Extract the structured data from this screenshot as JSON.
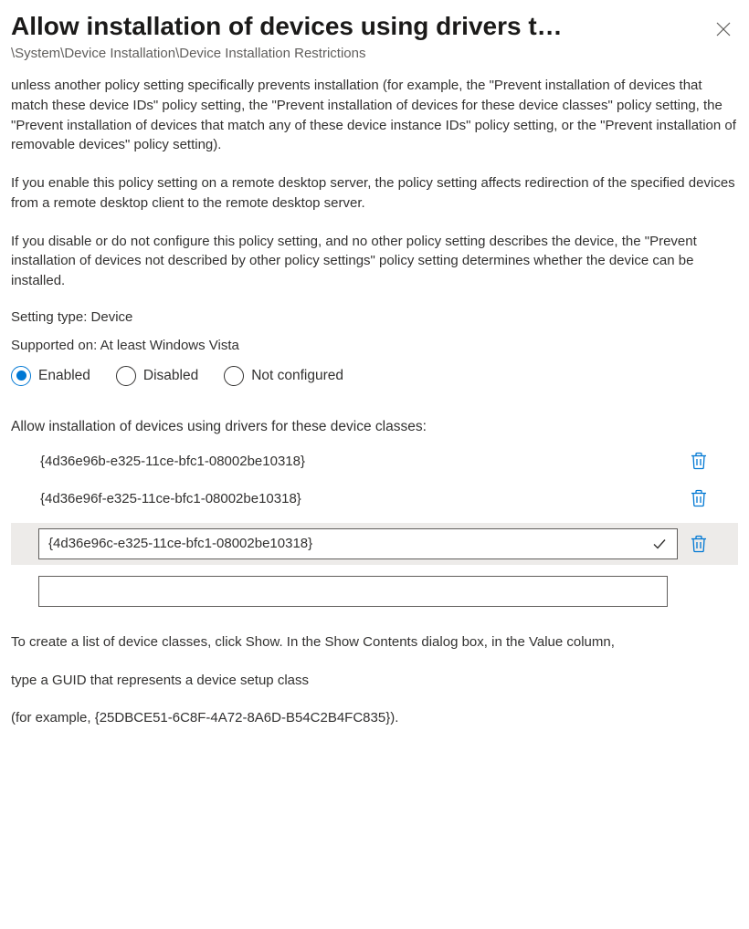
{
  "header": {
    "title": "Allow installation of devices using drivers t…",
    "breadcrumb": "\\System\\Device Installation\\Device Installation Restrictions"
  },
  "description": {
    "p1": "unless another policy setting specifically prevents installation (for example, the \"Prevent installation of devices that match these device IDs\" policy setting, the \"Prevent installation of devices for these device classes\" policy setting, the \"Prevent installation of devices that match any of these device instance IDs\" policy setting, or the \"Prevent installation of removable devices\" policy setting).",
    "p2": "If you enable this policy setting on a remote desktop server, the policy setting affects redirection of the specified devices from a remote desktop client to the remote desktop server.",
    "p3": "If you disable or do not configure this policy setting, and no other policy setting describes the device, the \"Prevent installation of devices not described by other policy settings\" policy setting determines whether the device can be installed."
  },
  "meta": {
    "setting_type": "Setting type: Device",
    "supported_on": "Supported on: At least Windows Vista"
  },
  "radio": {
    "selected": "enabled",
    "options": {
      "enabled": "Enabled",
      "disabled": "Disabled",
      "not_configured": "Not configured"
    }
  },
  "device_list": {
    "label": "Allow installation of devices using drivers for these device classes:",
    "rows": [
      {
        "value": "{4d36e96b-e325-11ce-bfc1-08002be10318}",
        "editing": false
      },
      {
        "value": "{4d36e96f-e325-11ce-bfc1-08002be10318}",
        "editing": false
      },
      {
        "value": "{4d36e96c-e325-11ce-bfc1-08002be10318}",
        "editing": true
      }
    ],
    "new_value": ""
  },
  "footer": {
    "p1": "To create a list of device classes, click Show. In the Show Contents dialog box, in the Value column,",
    "p2": "type a GUID that represents a device setup class",
    "p3": "(for example, {25DBCE51-6C8F-4A72-8A6D-B54C2B4FC835})."
  }
}
